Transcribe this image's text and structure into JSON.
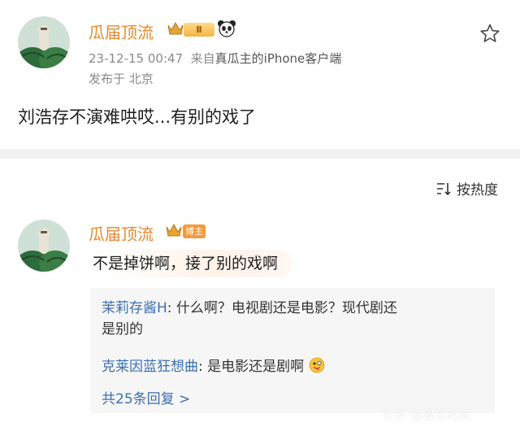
{
  "post": {
    "author": "瓜届顶流",
    "vip_level": "Ⅱ",
    "time": "23-12-15 00:47",
    "source_prefix": "来自",
    "source": "真瓜主的iPhone客户端",
    "location": "发布于 北京",
    "text": "刘浩存不演难哄哎...有别的戏了"
  },
  "comments_header": {
    "sort_label": "按热度"
  },
  "comment": {
    "author": "瓜届顶流",
    "badge": "博主",
    "text": "不是掉饼啊，接了别的戏啊",
    "replies": [
      {
        "user": "茉莉存酱H",
        "line1": ": 什么啊？电视剧还是电影？现代剧还",
        "line2": "是别的"
      },
      {
        "user": "克莱因蓝狂想曲",
        "line1": ": 是电影还是剧啊"
      }
    ],
    "reply_count_label": "共25条回复 >"
  },
  "watermark": "头条 @娱乐时间"
}
